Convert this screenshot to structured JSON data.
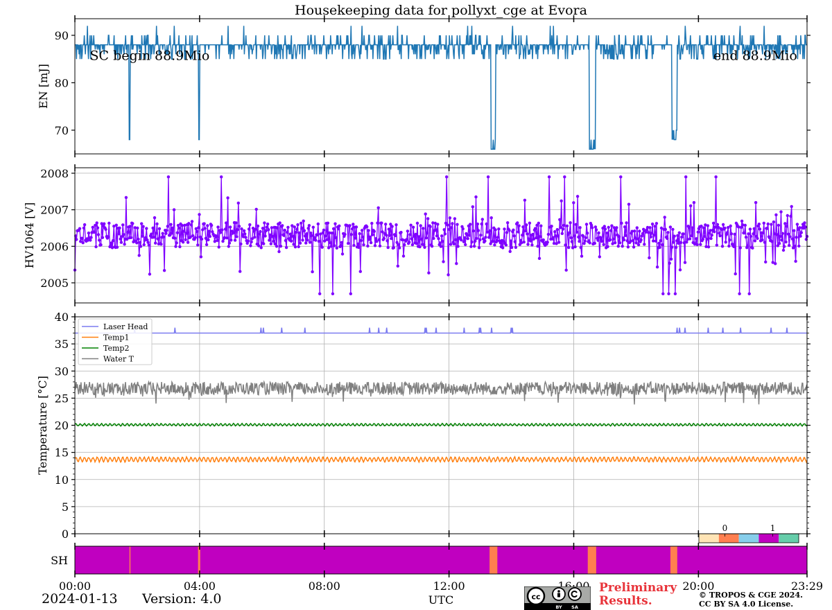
{
  "chart_data": {
    "title": "Housekeeping data for pollyxt_cge at Evora",
    "type": "line",
    "time_axis": {
      "label": "UTC",
      "range_hours": [
        0,
        23.483
      ],
      "tick_labels": [
        "00:00",
        "04:00",
        "08:00",
        "12:00",
        "16:00",
        "20:00",
        "23:29"
      ],
      "tick_hours": [
        0,
        4,
        8,
        12,
        16,
        20,
        23.483
      ]
    },
    "panels": [
      {
        "id": "energy",
        "ylabel": "EN [mJ]",
        "ylim": [
          65,
          93.5
        ],
        "yticks": [
          70,
          80,
          90
        ],
        "grid": false,
        "annotations": [
          {
            "text": "SC begin 88.9Mio",
            "hour": 0.3,
            "y": 84.5
          },
          {
            "text": "end 88.9Mio",
            "hour": 20.3,
            "y": 84.5
          }
        ],
        "series": [
          {
            "color": "#1f77b4",
            "baseline": 88,
            "spike_values": [
              86,
              87,
              90,
              85
            ],
            "dips": [
              {
                "hour": 1.75,
                "value": 68
              },
              {
                "hour": 3.98,
                "value": 68
              },
              {
                "hour_start": 13.35,
                "hour_end": 13.5,
                "value": 66
              },
              {
                "hour_start": 16.5,
                "hour_end": 16.7,
                "value": 66
              },
              {
                "hour_start": 19.15,
                "hour_end": 19.32,
                "value": 68
              }
            ]
          }
        ]
      },
      {
        "id": "hv",
        "ylabel": "HV1064 [V]",
        "ylim": [
          2004.45,
          2008.15
        ],
        "yticks": [
          2005,
          2006,
          2007,
          2008
        ],
        "grid": true,
        "series": [
          {
            "color": "#7f00ff",
            "center": 2006.3,
            "min": 2004.6,
            "max": 2008.0,
            "marker": "dot"
          }
        ]
      },
      {
        "id": "temperature",
        "ylabel": "Temperature [$^\\circ C$]",
        "ylim": [
          0,
          40
        ],
        "yticks": [
          0,
          5,
          10,
          15,
          20,
          25,
          30,
          35,
          40
        ],
        "grid": true,
        "legend": "top-left",
        "series": [
          {
            "name": "Laser Head",
            "color": "#7b7bf0",
            "baseline": 37,
            "spike": 38
          },
          {
            "name": "Temp1",
            "color": "#ff7f0e",
            "baseline": 13.7,
            "amplitude": 0.4
          },
          {
            "name": "Temp2",
            "color": "#008000",
            "baseline": 20.1,
            "amplitude": 0.2
          },
          {
            "name": "Water T",
            "color": "#808080",
            "baseline": 26.8,
            "amplitude": 1.2
          }
        ],
        "colorbar_ticks": [
          "0",
          "1"
        ],
        "colorbar_colors": [
          "#ffe4b5",
          "#ff7f50",
          "#87ceeb",
          "#c000c0",
          "#66cdaa"
        ]
      },
      {
        "id": "sh",
        "ylabel": "SH",
        "type": "state",
        "default_color": "#c000c0",
        "events": [
          {
            "hour_start": 1.75,
            "hour_end": 1.78,
            "color": "#ff7f50"
          },
          {
            "hour_start": 3.95,
            "hour_end": 4.02,
            "color": "#ff7f50"
          },
          {
            "hour_start": 13.3,
            "hour_end": 13.55,
            "color": "#ff7f50"
          },
          {
            "hour_start": 16.45,
            "hour_end": 16.72,
            "color": "#ff7f50"
          },
          {
            "hour_start": 19.1,
            "hour_end": 19.32,
            "color": "#ff7f50"
          }
        ]
      }
    ]
  },
  "footer": {
    "date": "2024-01-13",
    "version": "Version: 4.0",
    "preliminary": "Preliminary\nResults.",
    "copyright": "© TROPOS & CGE 2024.\nCC BY SA 4.0 License.",
    "cc_badge_icon": "cc-by-sa-icon"
  }
}
